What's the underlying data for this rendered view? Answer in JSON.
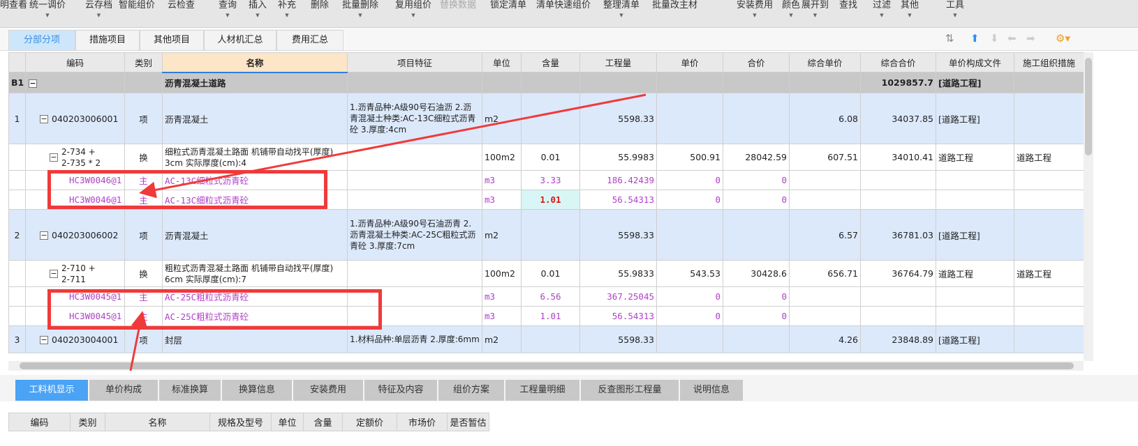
{
  "toolbar": {
    "items": [
      {
        "label": "明查看",
        "dd": false
      },
      {
        "label": "统一调价",
        "dd": true
      },
      {
        "label": "云存档",
        "dd": true
      },
      {
        "label": "智能组价",
        "dd": false
      },
      {
        "label": "云检查",
        "dd": false
      },
      {
        "label": "查询",
        "dd": true
      },
      {
        "label": "插入",
        "dd": true
      },
      {
        "label": "补充",
        "dd": true
      },
      {
        "label": "删除",
        "dd": false
      },
      {
        "label": "批量删除",
        "dd": true
      },
      {
        "label": "复用组价",
        "dd": true
      },
      {
        "label": "替换数据",
        "dd": false,
        "disabled": true
      },
      {
        "label": "锁定清单",
        "dd": false
      },
      {
        "label": "清单快速组价",
        "dd": false
      },
      {
        "label": "整理清单",
        "dd": true
      },
      {
        "label": "批量改主材",
        "dd": false
      },
      {
        "label": "安装费用",
        "dd": true
      },
      {
        "label": "颜色",
        "dd": true
      },
      {
        "label": "展开到",
        "dd": true
      },
      {
        "label": "查找",
        "dd": false
      },
      {
        "label": "过滤",
        "dd": true
      },
      {
        "label": "其他",
        "dd": true
      },
      {
        "label": "工具",
        "dd": true
      }
    ]
  },
  "tabs": [
    "分部分项",
    "措施项目",
    "其他项目",
    "人材机汇总",
    "费用汇总"
  ],
  "right_icons": [
    "sort-icon",
    "move-up-icon",
    "move-down-icon",
    "move-left-icon",
    "move-right-icon",
    "column-settings-icon"
  ],
  "grid": {
    "columns": [
      "",
      "编码",
      "类别",
      "名称",
      "项目特征",
      "单位",
      "含量",
      "工程量",
      "单价",
      "合价",
      "综合单价",
      "综合合价",
      "单价构成文件",
      "施工组织措施"
    ],
    "rows": [
      {
        "kind": "grp",
        "cells": [
          "B1",
          "",
          "",
          "沥青混凝土道路",
          "",
          "",
          "",
          "",
          "",
          "",
          "",
          "1029857.7",
          "[道路工程]",
          ""
        ]
      },
      {
        "kind": "item",
        "cells": [
          "1",
          "040203006001",
          "项",
          "沥青混凝土",
          "1.沥青品种:A级90号石油沥\n2.沥青混凝土种类:AC-13C细粒式沥青砼\n3.厚度:4cm",
          "m2",
          "",
          "5598.33",
          "",
          "",
          "6.08",
          "34037.85",
          "[道路工程]",
          ""
        ]
      },
      {
        "kind": "sub",
        "cells": [
          "",
          "2-734 +\n2-735 * 2",
          "换",
          "细粒式沥青混凝土路面 机铺带自动找平(厚度) 3cm  实际厚度(cm):4",
          "",
          "100m2",
          "0.01",
          "55.9983",
          "500.91",
          "28042.59",
          "607.51",
          "34010.41",
          "道路工程",
          "道路工程"
        ]
      },
      {
        "kind": "mat",
        "cells": [
          "",
          "HC3W0046@1",
          "主",
          "AC-13C细粒式沥青砼",
          "",
          "m3",
          "3.33",
          "186.42439",
          "0",
          "0",
          "",
          "",
          "",
          ""
        ]
      },
      {
        "kind": "mat",
        "hl": true,
        "cells": [
          "",
          "HC3W0046@1",
          "主",
          "AC-13C细粒式沥青砼",
          "",
          "m3",
          "1.01",
          "56.54313",
          "0",
          "0",
          "",
          "",
          "",
          ""
        ]
      },
      {
        "kind": "item",
        "cells": [
          "2",
          "040203006002",
          "项",
          "沥青混凝土",
          "1.沥青品种:A级90号石油沥青\n2.沥青混凝土种类:AC-25C粗粒式沥青砼\n3.厚度:7cm",
          "m2",
          "",
          "5598.33",
          "",
          "",
          "6.57",
          "36781.03",
          "[道路工程]",
          ""
        ]
      },
      {
        "kind": "sub",
        "cells": [
          "",
          "2-710 +\n2-711",
          "换",
          "粗粒式沥青混凝土路面 机铺带自动找平(厚度) 6cm  实际厚度(cm):7",
          "",
          "100m2",
          "0.01",
          "55.9833",
          "543.53",
          "30428.6",
          "656.71",
          "36764.79",
          "道路工程",
          "道路工程"
        ]
      },
      {
        "kind": "mat",
        "cells": [
          "",
          "HC3W0045@1",
          "主",
          "AC-25C粗粒式沥青砼",
          "",
          "m3",
          "6.56",
          "367.25045",
          "0",
          "0",
          "",
          "",
          "",
          ""
        ]
      },
      {
        "kind": "mat",
        "cells": [
          "",
          "HC3W0045@1",
          "主",
          "AC-25C粗粒式沥青砼",
          "",
          "m3",
          "1.01",
          "56.54313",
          "0",
          "0",
          "",
          "",
          "",
          ""
        ]
      },
      {
        "kind": "item",
        "cells": [
          "3",
          "040203004001",
          "项",
          "封层",
          "1.材料品种:单层沥青\n2.厚度:6mm",
          "m2",
          "",
          "5598.33",
          "",
          "",
          "4.26",
          "23848.89",
          "[道路工程]",
          ""
        ]
      }
    ]
  },
  "bottom_tabs": [
    "工料机显示",
    "单价构成",
    "标准换算",
    "换算信息",
    "安装费用",
    "特征及内容",
    "组价方案",
    "工程量明细",
    "反查图形工程量",
    "说明信息"
  ],
  "bottom_columns": [
    "编码",
    "类别",
    "名称",
    "规格及型号",
    "单位",
    "含量",
    "定额价",
    "市场价",
    "是否暂估"
  ],
  "colors": {
    "material_text": "#b040c8",
    "annotation_red": "#f03a3a",
    "active_tab": "#4aa3f5",
    "item_row": "#dce9fb"
  }
}
